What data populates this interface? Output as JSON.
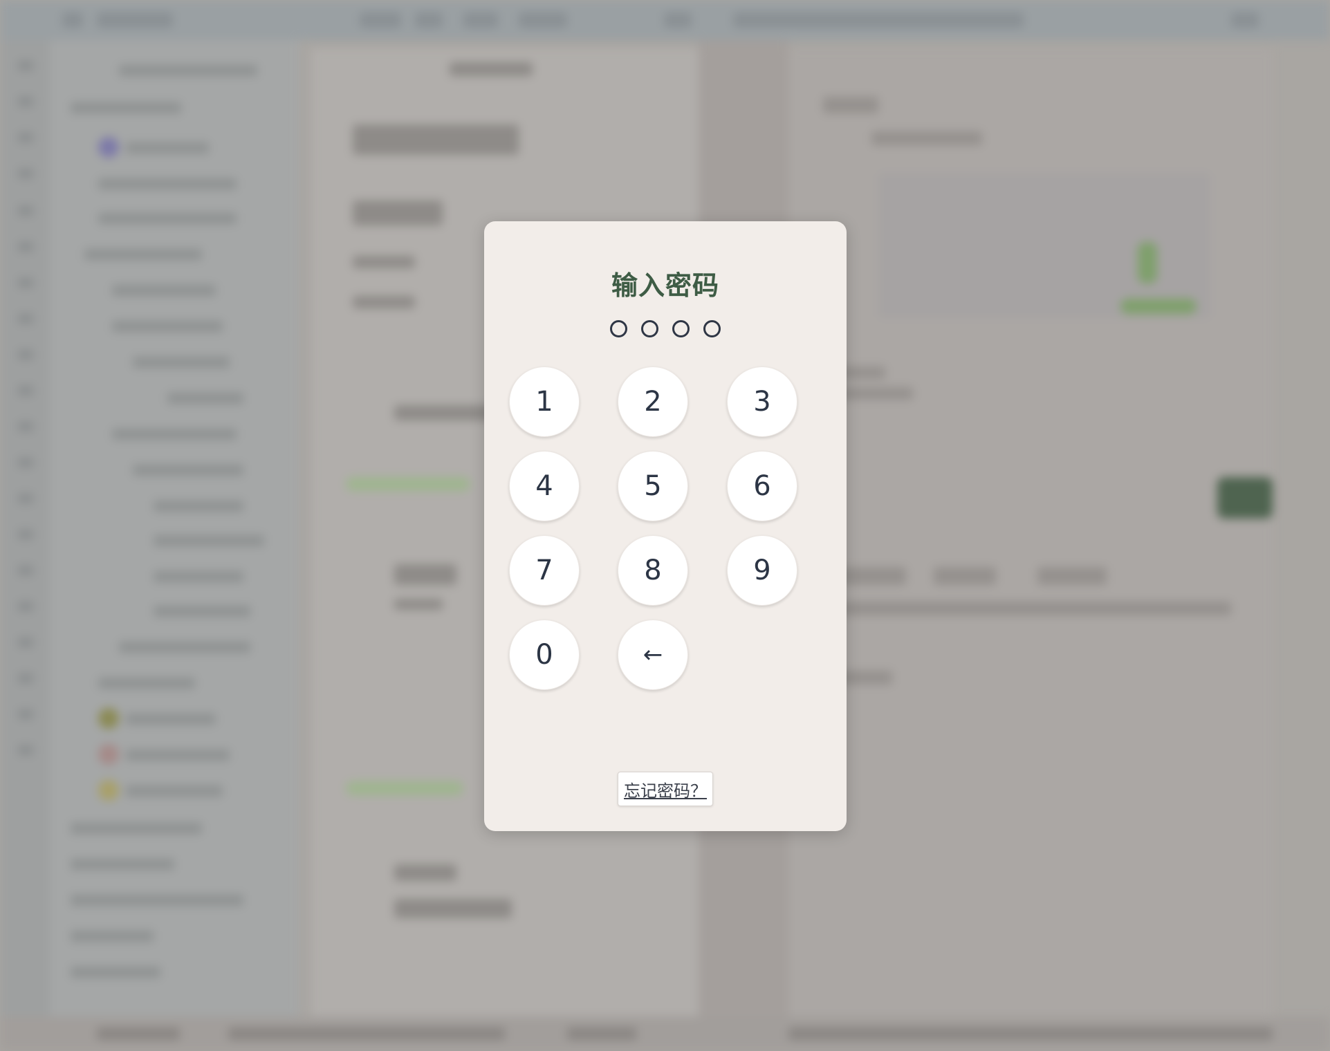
{
  "modal": {
    "title": "输入密码",
    "pin_length": 4,
    "pin_entered": 0,
    "keys": [
      {
        "label": "1",
        "name": "key-1"
      },
      {
        "label": "2",
        "name": "key-2"
      },
      {
        "label": "3",
        "name": "key-3"
      },
      {
        "label": "4",
        "name": "key-4"
      },
      {
        "label": "5",
        "name": "key-5"
      },
      {
        "label": "6",
        "name": "key-6"
      },
      {
        "label": "7",
        "name": "key-7"
      },
      {
        "label": "8",
        "name": "key-8"
      },
      {
        "label": "9",
        "name": "key-9"
      },
      {
        "label": "0",
        "name": "key-0"
      },
      {
        "label": "←",
        "name": "backspace-key"
      }
    ],
    "forgot_label": "忘记密码？"
  },
  "colors": {
    "title": "#3e5c45",
    "modal_background": "#f2ede9",
    "dot_outline": "#2f3645"
  }
}
